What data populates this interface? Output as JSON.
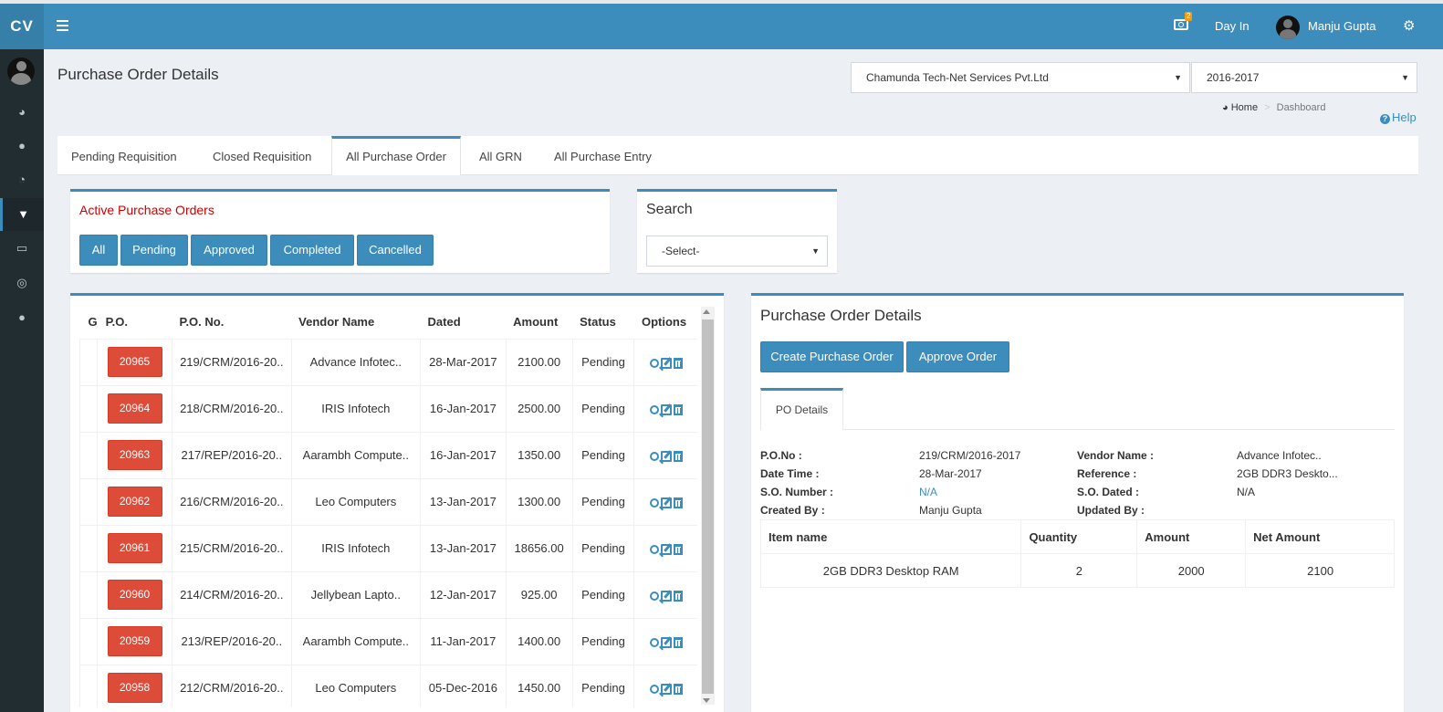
{
  "app": {
    "logo": "CV"
  },
  "topbar": {
    "badge": "2",
    "day_in": "Day In",
    "user": "Manju Gupta"
  },
  "page": {
    "title": "Purchase Order Details"
  },
  "company_select": {
    "value": "Chamunda Tech-Net Services Pvt.Ltd"
  },
  "year_select": {
    "value": "2016-2017"
  },
  "breadcrumb": {
    "home": "Home",
    "separator": ">",
    "current": "Dashboard"
  },
  "help": "Help",
  "tabs": [
    "Pending Requisition",
    "Closed Requisition",
    "All Purchase Order",
    "All GRN",
    "All Purchase Entry"
  ],
  "active_orders": {
    "title": "Active Purchase Orders",
    "filters": [
      "All",
      "Pending",
      "Approved",
      "Completed",
      "Cancelled"
    ]
  },
  "search": {
    "title": "Search",
    "select_value": "-Select-"
  },
  "po_table": {
    "headers": [
      "G",
      "P.O.",
      "P.O. No.",
      "Vendor Name",
      "Dated",
      "Amount",
      "Status",
      "Options"
    ],
    "rows": [
      {
        "po": "20965",
        "po_no": "219/CRM/2016-20..",
        "vendor": "Advance Infotec..",
        "dated": "28-Mar-2017",
        "amount": "2100.00",
        "status": "Pending"
      },
      {
        "po": "20964",
        "po_no": "218/CRM/2016-20..",
        "vendor": "IRIS Infotech",
        "dated": "16-Jan-2017",
        "amount": "2500.00",
        "status": "Pending"
      },
      {
        "po": "20963",
        "po_no": "217/REP/2016-20..",
        "vendor": "Aarambh Compute..",
        "dated": "16-Jan-2017",
        "amount": "1350.00",
        "status": "Pending"
      },
      {
        "po": "20962",
        "po_no": "216/CRM/2016-20..",
        "vendor": "Leo Computers",
        "dated": "13-Jan-2017",
        "amount": "1300.00",
        "status": "Pending"
      },
      {
        "po": "20961",
        "po_no": "215/CRM/2016-20..",
        "vendor": "IRIS Infotech",
        "dated": "13-Jan-2017",
        "amount": "18656.00",
        "status": "Pending"
      },
      {
        "po": "20960",
        "po_no": "214/CRM/2016-20..",
        "vendor": "Jellybean Lapto..",
        "dated": "12-Jan-2017",
        "amount": "925.00",
        "status": "Pending"
      },
      {
        "po": "20959",
        "po_no": "213/REP/2016-20..",
        "vendor": "Aarambh Compute..",
        "dated": "11-Jan-2017",
        "amount": "1400.00",
        "status": "Pending"
      },
      {
        "po": "20958",
        "po_no": "212/CRM/2016-20..",
        "vendor": "Leo Computers",
        "dated": "05-Dec-2016",
        "amount": "1450.00",
        "status": "Pending"
      }
    ]
  },
  "details": {
    "title": "Purchase Order Details",
    "create_btn": "Create Purchase Order",
    "approve_btn": "Approve Order",
    "tab": "PO Details",
    "po_no_label": "P.O.No :",
    "po_no": "219/CRM/2016-2017",
    "vendor_label": "Vendor Name :",
    "vendor": "Advance Infotec..",
    "datetime_label": "Date Time :",
    "datetime": "28-Mar-2017",
    "reference_label": "Reference :",
    "reference": "2GB DDR3 Deskto...",
    "so_number_label": "S.O. Number :",
    "so_number": "N/A",
    "so_dated_label": "S.O. Dated :",
    "so_dated": "N/A",
    "created_by_label": "Created By :",
    "created_by": "Manju Gupta",
    "updated_by_label": "Updated By :",
    "items_headers": [
      "Item name",
      "Quantity",
      "Amount",
      "Net Amount"
    ],
    "items": [
      {
        "name": "2GB DDR3 Desktop RAM",
        "quantity": "2",
        "amount": "2000",
        "net_amount": "2100"
      }
    ]
  },
  "colors": {
    "primary": "#3c8dbc",
    "danger": "#dd4b39",
    "sidebar": "#222d32"
  }
}
